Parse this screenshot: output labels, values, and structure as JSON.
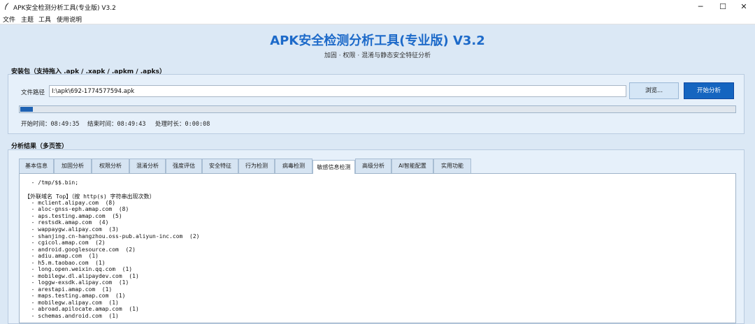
{
  "window": {
    "title": "APK安全检测分析工具(专业版) V3.2",
    "controls": [
      "─",
      "☐",
      "✕"
    ]
  },
  "menu": [
    "文件",
    "主题",
    "工具",
    "使用说明"
  ],
  "header": {
    "title": "APK安全检测分析工具(专业版)  V3.2",
    "subtitle": "加固 · 权限 · 混淆与静态安全特征分析"
  },
  "package_group": {
    "label": "安装包（支持拖入 .apk / .xapk / .apkm / .apks）",
    "path_label": "文件路径",
    "path_value": "I:\\apk\\692-1774577594.apk",
    "browse_label": "浏览...",
    "start_label": "开始分析",
    "progress_fraction": 0.018,
    "start_time": "开始时间：08:49:35",
    "end_time": "结束时间：08:49:43",
    "duration": "处理时长：0:00:08"
  },
  "results": {
    "label": "分析结果（多页签）",
    "tabs": [
      "基本信息",
      "加固分析",
      "权限分析",
      "混淆分析",
      "强度评估",
      "安全特征",
      "行为检测",
      "病毒检测",
      "敏感信息检测",
      "高级分析",
      "AI智能配置",
      "实用功能"
    ],
    "active_tab": 8,
    "lines": [
      "  - /tmp/$$.bin;",
      "",
      "【外联域名 Top】（按 http(s) 字符串出现次数）",
      "  - mclient.alipay.com  (8)",
      "  - aloc-gnss-eph.amap.com  (8)",
      "  - aps.testing.amap.com  (5)",
      "  - restsdk.amap.com  (4)",
      "  - wappaygw.alipay.com  (3)",
      "  - shanjing.cn-hangzhou.oss-pub.aliyun-inc.com  (2)",
      "  - cgicol.amap.com  (2)",
      "  - android.googlesource.com  (2)",
      "  - adiu.amap.com  (1)",
      "  - h5.m.taobao.com  (1)",
      "  - long.open.weixin.qq.com  (1)",
      "  - mobilegw.dl.alipaydev.com  (1)",
      "  - loggw-exsdk.alipay.com  (1)",
      "  - arestapi.amap.com  (1)",
      "  - maps.testing.amap.com  (1)",
      "  - mobilegw.alipay.com  (1)",
      "  - abroad.apilocate.amap.com  (1)",
      "  - schemas.android.com  (1)"
    ]
  }
}
